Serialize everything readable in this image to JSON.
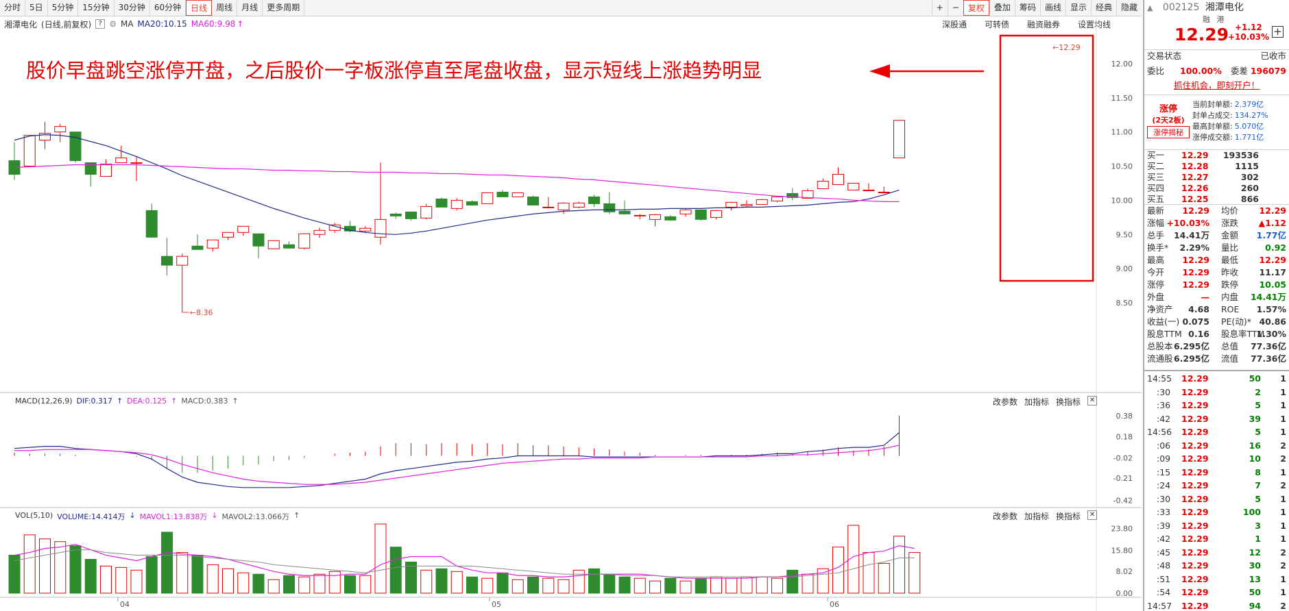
{
  "toolbar": {
    "left": [
      "分时",
      "5日",
      "5分钟",
      "15分钟",
      "30分钟",
      "60分钟",
      "日线",
      "周线",
      "月线",
      "更多周期"
    ],
    "active": "日线",
    "right": [
      "+",
      "−",
      "复权",
      "叠加",
      "筹码",
      "画线",
      "显示",
      "经典",
      "隐藏"
    ]
  },
  "header": {
    "name": "湘潭电化",
    "mode": "(日线,前复权)",
    "q": "?",
    "ma_label": "MA",
    "ma20": "MA20:10.15",
    "ma60": "MA60:9.98",
    "links": [
      "深股通",
      "可转债",
      "融资融券",
      "设置均线"
    ]
  },
  "annotation": "股价早盘跳空涨停开盘，之后股价一字板涨停直至尾盘收盘，显示短线上涨趋势明显",
  "colors": {
    "up": "#e60000",
    "down": "#2e8b2e",
    "ma20": "#1f2a8a",
    "ma60": "#e020e0",
    "box": "#e60000"
  },
  "chart_data": [
    {
      "type": "candlestick",
      "title": "湘潭电化 (日线,前复权)",
      "ylim": [
        8.3,
        12.45
      ],
      "yticks": [
        "12.00",
        "11.50",
        "11.00",
        "10.50",
        "10.00",
        "9.50",
        "9.00",
        "8.50"
      ],
      "xticks": [
        "04",
        "05",
        "06"
      ],
      "tick_label_min": "8.36",
      "tick_label_max": "12.29",
      "ohlc": [
        [
          10.58,
          10.85,
          10.3,
          10.38
        ],
        [
          10.5,
          10.95,
          10.5,
          10.95
        ],
        [
          10.88,
          11.15,
          10.75,
          10.98
        ],
        [
          11.0,
          11.12,
          10.85,
          11.08
        ],
        [
          11.0,
          11.0,
          10.55,
          10.58
        ],
        [
          10.55,
          10.55,
          10.2,
          10.38
        ],
        [
          10.35,
          10.6,
          10.35,
          10.53
        ],
        [
          10.55,
          10.8,
          10.55,
          10.62
        ],
        [
          10.55,
          10.65,
          10.28,
          10.55
        ],
        [
          9.85,
          9.95,
          9.45,
          9.46
        ],
        [
          9.18,
          9.45,
          8.9,
          9.05
        ],
        [
          9.05,
          9.22,
          8.36,
          9.18
        ],
        [
          9.33,
          9.5,
          9.3,
          9.28
        ],
        [
          9.3,
          9.42,
          9.25,
          9.42
        ],
        [
          9.46,
          9.53,
          9.42,
          9.53
        ],
        [
          9.53,
          9.6,
          9.48,
          9.62
        ],
        [
          9.51,
          9.51,
          9.15,
          9.33
        ],
        [
          9.29,
          9.41,
          9.29,
          9.41
        ],
        [
          9.35,
          9.4,
          9.3,
          9.3
        ],
        [
          9.3,
          9.52,
          9.28,
          9.51
        ],
        [
          9.5,
          9.6,
          9.45,
          9.56
        ],
        [
          9.56,
          9.67,
          9.52,
          9.64
        ],
        [
          9.62,
          9.7,
          9.53,
          9.55
        ],
        [
          9.55,
          9.62,
          9.52,
          9.59
        ],
        [
          9.46,
          10.55,
          9.35,
          9.72
        ],
        [
          9.8,
          9.82,
          9.73,
          9.77
        ],
        [
          9.83,
          9.83,
          9.7,
          9.73
        ],
        [
          9.74,
          9.95,
          9.72,
          9.91
        ],
        [
          10.02,
          10.04,
          9.9,
          9.9
        ],
        [
          9.88,
          10.03,
          9.85,
          10.0
        ],
        [
          9.98,
          10.0,
          9.92,
          9.93
        ],
        [
          9.95,
          10.11,
          9.95,
          10.11
        ],
        [
          10.12,
          10.15,
          10.08,
          10.05
        ],
        [
          10.05,
          10.11,
          10.05,
          10.11
        ],
        [
          10.05,
          10.07,
          9.93,
          9.93
        ],
        [
          9.9,
          10.05,
          9.88,
          9.9
        ],
        [
          9.86,
          9.97,
          9.8,
          9.96
        ],
        [
          9.9,
          9.98,
          9.88,
          9.96
        ],
        [
          10.05,
          10.08,
          9.9,
          9.95
        ],
        [
          9.95,
          10.12,
          9.8,
          9.83
        ],
        [
          9.84,
          10.0,
          9.79,
          9.8
        ],
        [
          9.78,
          9.8,
          9.72,
          9.78
        ],
        [
          9.72,
          9.8,
          9.62,
          9.79
        ],
        [
          9.76,
          9.78,
          9.7,
          9.71
        ],
        [
          9.8,
          9.88,
          9.76,
          9.86
        ],
        [
          9.86,
          9.86,
          9.7,
          9.72
        ],
        [
          9.75,
          9.86,
          9.72,
          9.85
        ],
        [
          9.9,
          9.98,
          9.85,
          9.97
        ],
        [
          9.92,
          10.0,
          9.9,
          9.94
        ],
        [
          9.94,
          10.02,
          9.94,
          10.01
        ],
        [
          9.99,
          10.05,
          9.97,
          10.05
        ],
        [
          10.1,
          10.18,
          10.0,
          10.04
        ],
        [
          10.03,
          10.17,
          10.03,
          10.14
        ],
        [
          10.17,
          10.32,
          10.16,
          10.28
        ],
        [
          10.23,
          10.48,
          10.23,
          10.38
        ],
        [
          10.15,
          10.25,
          10.15,
          10.25
        ],
        [
          10.15,
          10.25,
          10.15,
          10.15
        ],
        [
          10.12,
          10.2,
          10.1,
          10.12
        ],
        [
          10.62,
          11.17,
          10.62,
          11.17
        ]
      ],
      "ma20": [
        10.88,
        10.94,
        10.96,
        10.95,
        10.92,
        10.86,
        10.8,
        10.72,
        10.64,
        10.55,
        10.46,
        10.36,
        10.28,
        10.2,
        10.12,
        10.04,
        9.96,
        9.88,
        9.81,
        9.74,
        9.68,
        9.62,
        9.56,
        9.53,
        9.51,
        9.5,
        9.52,
        9.55,
        9.59,
        9.63,
        9.67,
        9.71,
        9.74,
        9.77,
        9.8,
        9.82,
        9.84,
        9.85,
        9.86,
        9.86,
        9.86,
        9.87,
        9.87,
        9.88,
        9.88,
        9.88,
        9.89,
        9.89,
        9.9,
        9.9,
        9.91,
        9.92,
        9.93,
        9.95,
        9.97,
        9.98,
        10.02,
        10.08,
        10.15
      ],
      "ma60": [
        10.48,
        10.49,
        10.5,
        10.51,
        10.52,
        10.52,
        10.52,
        10.52,
        10.52,
        10.51,
        10.5,
        10.49,
        10.48,
        10.47,
        10.46,
        10.46,
        10.45,
        10.44,
        10.44,
        10.43,
        10.43,
        10.42,
        10.42,
        10.41,
        10.41,
        10.41,
        10.4,
        10.4,
        10.39,
        10.39,
        10.38,
        10.37,
        10.37,
        10.36,
        10.35,
        10.34,
        10.33,
        10.31,
        10.3,
        10.28,
        10.26,
        10.24,
        10.22,
        10.2,
        10.18,
        10.16,
        10.14,
        10.12,
        10.1,
        10.08,
        10.06,
        10.05,
        10.04,
        10.03,
        10.02,
        10.0,
        9.99,
        9.98,
        9.98
      ]
    },
    {
      "type": "bar",
      "title": "MACD(12,26,9)",
      "series_labels": {
        "dif": "DIF:0.317",
        "dea": "DEA:0.125",
        "macd": "MACD:0.383"
      },
      "yticks": [
        "0.38",
        "0.18",
        "-0.02",
        "-0.21",
        "-0.42"
      ],
      "ylim": [
        -0.45,
        0.45
      ],
      "tools": [
        "改参数",
        "加指标",
        "换指标"
      ],
      "close": "✕",
      "macd": [
        0.03,
        0.02,
        0.02,
        0.02,
        0.01,
        0.0,
        0.0,
        0.0,
        -0.01,
        -0.04,
        -0.12,
        -0.16,
        -0.16,
        -0.14,
        -0.12,
        -0.09,
        -0.08,
        -0.05,
        -0.04,
        -0.02,
        0.0,
        0.02,
        0.03,
        0.04,
        0.09,
        0.12,
        0.12,
        0.11,
        0.12,
        0.12,
        0.11,
        0.12,
        0.11,
        0.12,
        0.1,
        0.1,
        0.09,
        0.08,
        0.07,
        0.06,
        0.04,
        0.03,
        0.01,
        0.0,
        0.01,
        0.01,
        0.0,
        0.01,
        0.01,
        0.02,
        0.03,
        0.02,
        0.04,
        0.06,
        0.08,
        0.05,
        0.06,
        0.09,
        0.38
      ],
      "dif": [
        0.07,
        0.08,
        0.09,
        0.09,
        0.07,
        0.06,
        0.05,
        0.04,
        0.02,
        -0.03,
        -0.12,
        -0.2,
        -0.25,
        -0.27,
        -0.29,
        -0.3,
        -0.3,
        -0.3,
        -0.3,
        -0.29,
        -0.28,
        -0.26,
        -0.24,
        -0.22,
        -0.17,
        -0.14,
        -0.12,
        -0.1,
        -0.08,
        -0.06,
        -0.05,
        -0.03,
        -0.02,
        0.0,
        0.0,
        0.0,
        0.0,
        0.0,
        -0.01,
        -0.01,
        -0.01,
        -0.01,
        -0.01,
        -0.01,
        -0.01,
        -0.01,
        0.0,
        0.0,
        0.0,
        0.01,
        0.02,
        0.02,
        0.04,
        0.05,
        0.07,
        0.08,
        0.08,
        0.1,
        0.22
      ],
      "dea": [
        0.05,
        0.05,
        0.06,
        0.06,
        0.06,
        0.06,
        0.05,
        0.04,
        0.03,
        0.01,
        -0.03,
        -0.08,
        -0.12,
        -0.16,
        -0.19,
        -0.22,
        -0.24,
        -0.25,
        -0.26,
        -0.27,
        -0.27,
        -0.27,
        -0.26,
        -0.25,
        -0.23,
        -0.21,
        -0.19,
        -0.17,
        -0.15,
        -0.13,
        -0.11,
        -0.09,
        -0.07,
        -0.06,
        -0.05,
        -0.04,
        -0.03,
        -0.03,
        -0.02,
        -0.02,
        -0.02,
        -0.02,
        -0.01,
        -0.01,
        -0.01,
        -0.01,
        -0.01,
        -0.01,
        -0.01,
        0.0,
        0.0,
        0.01,
        0.01,
        0.02,
        0.03,
        0.04,
        0.05,
        0.07,
        0.1
      ]
    },
    {
      "type": "bar",
      "title": "VOL(5,10)",
      "series_labels": {
        "volume": "VOLUME:14.414万",
        "mavol1": "MAVOL1:13.838万",
        "mavol2": "MAVOL2:13.066万"
      },
      "yticks": [
        "23.80",
        "15.80",
        "8.02",
        "0.00"
      ],
      "ylim": [
        0,
        26
      ],
      "tools": [
        "改参数",
        "加指标",
        "换指标"
      ],
      "close": "✕",
      "vol": [
        14.0,
        21.5,
        20.0,
        19.0,
        17.5,
        12.5,
        10.0,
        9.5,
        8.5,
        13.5,
        22.5,
        15.0,
        14.0,
        10.5,
        9.0,
        7.5,
        7.0,
        5.0,
        6.5,
        6.0,
        7.0,
        8.0,
        6.5,
        6.5,
        25.5,
        17.0,
        11.5,
        8.5,
        9.0,
        8.0,
        6.0,
        5.5,
        7.5,
        5.0,
        6.0,
        5.5,
        5.0,
        8.5,
        9.0,
        7.0,
        6.0,
        5.5,
        4.5,
        5.5,
        4.5,
        5.5,
        6.0,
        5.5,
        6.0,
        6.0,
        5.5,
        8.5,
        7.0,
        9.0,
        17.0,
        25.0,
        15.0,
        11.0,
        21.0,
        15.0
      ],
      "mavol1": [
        14.0,
        15.0,
        16.5,
        17.0,
        18.0,
        16.0,
        14.0,
        13.0,
        12.0,
        13.5,
        15.0,
        14.5,
        14.0,
        13.5,
        12.5,
        11.0,
        9.5,
        8.0,
        7.0,
        6.5,
        6.5,
        6.5,
        7.0,
        7.0,
        10.5,
        12.5,
        13.5,
        13.5,
        13.5,
        10.0,
        8.5,
        7.5,
        7.5,
        6.5,
        6.5,
        6.0,
        6.0,
        6.5,
        7.0,
        7.0,
        7.0,
        7.0,
        6.5,
        6.0,
        5.5,
        5.5,
        5.5,
        5.5,
        5.5,
        6.0,
        6.0,
        6.5,
        7.0,
        7.5,
        9.5,
        13.5,
        15.0,
        15.5,
        17.5,
        16.5
      ],
      "mavol2": [
        12.0,
        13.0,
        14.0,
        15.0,
        16.0,
        16.0,
        15.0,
        14.5,
        14.0,
        14.0,
        14.0,
        14.0,
        13.5,
        13.0,
        12.5,
        12.0,
        11.5,
        10.5,
        10.0,
        9.5,
        9.0,
        8.5,
        8.0,
        7.5,
        8.5,
        9.5,
        10.0,
        10.0,
        10.0,
        10.0,
        10.0,
        9.5,
        9.0,
        8.5,
        8.0,
        7.5,
        7.0,
        7.0,
        7.0,
        7.0,
        6.5,
        6.5,
        6.5,
        6.0,
        6.0,
        6.0,
        6.0,
        6.0,
        6.0,
        6.0,
        6.0,
        6.0,
        6.5,
        7.0,
        7.5,
        9.0,
        10.5,
        11.5,
        13.0,
        13.0
      ]
    }
  ],
  "right_panel": {
    "code": "002125",
    "name": "湘潭电化",
    "tags": [
      "融",
      "港"
    ],
    "price": "12.29",
    "change": "+1.12",
    "pct": "+10.03%",
    "add": "+",
    "trade_status_label": "交易状态",
    "trade_status": "已收市",
    "weibi_label": "委比",
    "weibi": "100.00%",
    "weicha_label": "委差",
    "weicha": "196079",
    "promo": "抓住机会，即刻开户！",
    "limit": {
      "title": "涨停",
      "sub": "(2天2板)",
      "btn": "涨停揭秘",
      "rows": [
        {
          "label": "当前封单额:",
          "value": "2.379亿"
        },
        {
          "label": "封单占成交:",
          "value": "134.27%"
        },
        {
          "label": "最高封单额:",
          "value": "5.070亿"
        },
        {
          "label": "涨停成交额:",
          "value": "1.771亿"
        }
      ]
    },
    "bids": [
      {
        "label": "买一",
        "price": "12.29",
        "vol": "193536"
      },
      {
        "label": "买二",
        "price": "12.28",
        "vol": "1115"
      },
      {
        "label": "买三",
        "price": "12.27",
        "vol": "302"
      },
      {
        "label": "买四",
        "price": "12.26",
        "vol": "260"
      },
      {
        "label": "买五",
        "price": "12.25",
        "vol": "866"
      }
    ],
    "stats": [
      {
        "l1": "最新",
        "v1": "12.29",
        "c1": "red",
        "l2": "均价",
        "v2": "12.29",
        "c2": "red"
      },
      {
        "l1": "涨幅",
        "v1": "+10.03%",
        "c1": "red",
        "l2": "涨跌",
        "v2": "▲1.12",
        "c2": "red"
      },
      {
        "l1": "总手",
        "v1": "14.41万",
        "c1": "",
        "l2": "金额",
        "v2": "1.77亿",
        "c2": "blue"
      },
      {
        "l1": "换手*",
        "v1": "2.29%",
        "c1": "",
        "l2": "量比",
        "v2": "0.92",
        "c2": "green"
      },
      {
        "l1": "最高",
        "v1": "12.29",
        "c1": "red",
        "l2": "最低",
        "v2": "12.29",
        "c2": "red"
      },
      {
        "l1": "今开",
        "v1": "12.29",
        "c1": "red",
        "l2": "昨收",
        "v2": "11.17",
        "c2": ""
      },
      {
        "l1": "涨停",
        "v1": "12.29",
        "c1": "red",
        "l2": "跌停",
        "v2": "10.05",
        "c2": "green"
      },
      {
        "l1": "外盘",
        "v1": "—",
        "c1": "red",
        "l2": "内盘",
        "v2": "14.41万",
        "c2": "green"
      },
      {
        "l1": "净资产",
        "v1": "4.68",
        "c1": "",
        "l2": "ROE",
        "v2": "1.57%",
        "c2": ""
      },
      {
        "l1": "收益(一)",
        "v1": "0.075",
        "c1": "",
        "l2": "PE(动)*",
        "v2": "40.86",
        "c2": ""
      },
      {
        "l1": "股息TTM",
        "v1": "0.16",
        "c1": "",
        "l2": "股息率TTM",
        "v2": "1.30%",
        "c2": ""
      },
      {
        "l1": "总股本",
        "v1": "6.295亿",
        "c1": "",
        "l2": "总值",
        "v2": "77.36亿",
        "c2": ""
      },
      {
        "l1": "流通股",
        "v1": "6.295亿",
        "c1": "",
        "l2": "流值",
        "v2": "77.36亿",
        "c2": ""
      }
    ],
    "ticks": [
      {
        "t": "14:55",
        "p": "12.29",
        "v": "50",
        "n": "1"
      },
      {
        "t": ":30",
        "p": "12.29",
        "v": "2",
        "n": "1"
      },
      {
        "t": ":36",
        "p": "12.29",
        "v": "5",
        "n": "1"
      },
      {
        "t": ":42",
        "p": "12.29",
        "v": "39",
        "n": "1"
      },
      {
        "t": "14:56",
        "p": "12.29",
        "v": "5",
        "n": "1"
      },
      {
        "t": ":06",
        "p": "12.29",
        "v": "16",
        "n": "2"
      },
      {
        "t": ":09",
        "p": "12.29",
        "v": "10",
        "n": "2"
      },
      {
        "t": ":15",
        "p": "12.29",
        "v": "8",
        "n": "1"
      },
      {
        "t": ":24",
        "p": "12.29",
        "v": "7",
        "n": "2"
      },
      {
        "t": ":30",
        "p": "12.29",
        "v": "5",
        "n": "1"
      },
      {
        "t": ":33",
        "p": "12.29",
        "v": "100",
        "n": "1"
      },
      {
        "t": ":39",
        "p": "12.29",
        "v": "3",
        "n": "1"
      },
      {
        "t": ":42",
        "p": "12.29",
        "v": "1",
        "n": "1"
      },
      {
        "t": ":45",
        "p": "12.29",
        "v": "12",
        "n": "2"
      },
      {
        "t": ":48",
        "p": "12.29",
        "v": "30",
        "n": "2"
      },
      {
        "t": ":51",
        "p": "12.29",
        "v": "13",
        "n": "1"
      },
      {
        "t": ":54",
        "p": "12.29",
        "v": "50",
        "n": "1"
      },
      {
        "t": "14:57",
        "p": "12.29",
        "v": "94",
        "n": "2"
      }
    ]
  }
}
